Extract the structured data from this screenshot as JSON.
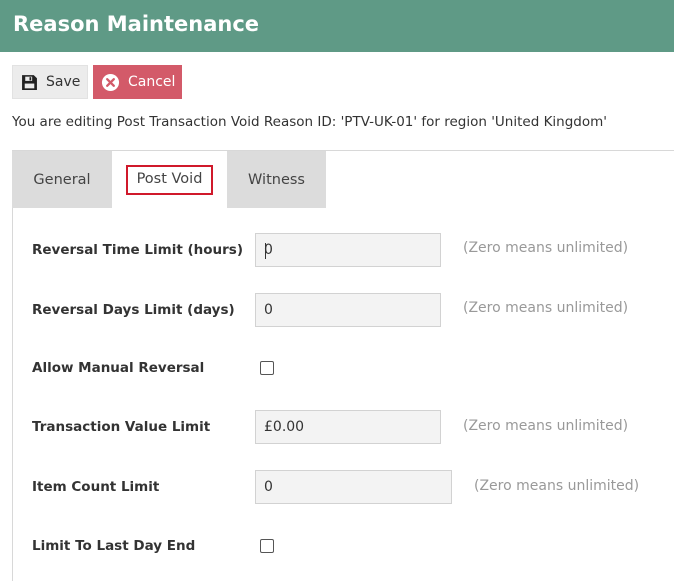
{
  "header": {
    "title": "Reason Maintenance"
  },
  "toolbar": {
    "save_label": "Save",
    "cancel_label": "Cancel"
  },
  "info_text": "You are editing Post Transaction Void Reason ID: 'PTV-UK-01' for region 'United Kingdom'",
  "tabs": [
    {
      "label": "General",
      "selected": false
    },
    {
      "label": "Post Void",
      "selected": true
    },
    {
      "label": "Witness",
      "selected": false
    }
  ],
  "fields": {
    "reversal_time_limit": {
      "label": "Reversal Time Limit (hours)",
      "value": "0",
      "hint": "(Zero means unlimited)"
    },
    "reversal_days_limit": {
      "label": "Reversal Days Limit (days)",
      "value": "0",
      "hint": "(Zero means unlimited)"
    },
    "allow_manual_reversal": {
      "label": "Allow Manual Reversal",
      "checked": false
    },
    "transaction_value_limit": {
      "label": "Transaction Value Limit",
      "value": "£0.00",
      "hint": "(Zero means unlimited)"
    },
    "item_count_limit": {
      "label": "Item Count Limit",
      "value": "0",
      "hint": "(Zero means unlimited)"
    },
    "limit_to_last_day_end": {
      "label": "Limit To Last Day End",
      "checked": false
    }
  },
  "colors": {
    "header_bg": "#5f9a86",
    "cancel_bg": "#d35a69",
    "tab_highlight": "#d0192b"
  },
  "icons": {
    "save": "floppy-disk-icon",
    "cancel": "close-circle-icon"
  }
}
